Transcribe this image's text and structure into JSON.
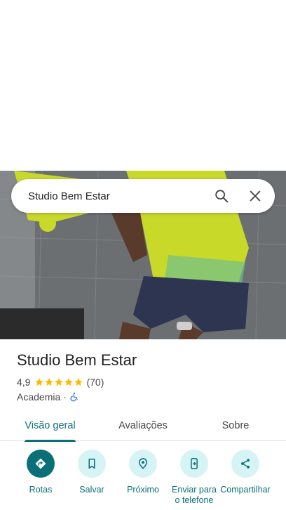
{
  "search": {
    "query": "Studio Bem Estar",
    "search_icon": "search-icon",
    "close_icon": "close-icon"
  },
  "place": {
    "name": "Studio Bem Estar",
    "rating": "4,9",
    "stars": 5,
    "review_count": "(70)",
    "category": "Academia",
    "separator": "·",
    "accessibility_icon": "wheelchair-icon"
  },
  "tabs": [
    {
      "label": "Visão geral",
      "active": true
    },
    {
      "label": "Avaliações",
      "active": false
    },
    {
      "label": "Sobre",
      "active": false
    }
  ],
  "actions": [
    {
      "label": "Rotas",
      "icon": "directions-icon"
    },
    {
      "label": "Salvar",
      "icon": "bookmark-icon"
    },
    {
      "label": "Próximo",
      "icon": "nearby-icon"
    },
    {
      "label": "Enviar para o telefone",
      "icon": "send-to-phone-icon"
    },
    {
      "label": "Compartilhar",
      "icon": "share-icon"
    }
  ],
  "colors": {
    "accent": "#0b6f77",
    "action_bg": "#d6f3f5",
    "star": "#fbbc04",
    "accessibility": "#1a73e8"
  }
}
